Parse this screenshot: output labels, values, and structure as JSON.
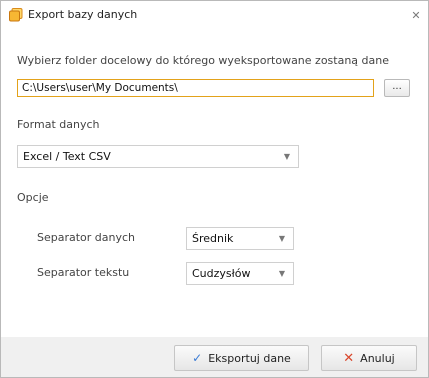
{
  "window": {
    "title": "Export bazy danych",
    "icon": "export-database-icon",
    "close": "✕"
  },
  "folder": {
    "label": "Wybierz folder docelowy do którego wyeksportowane zostaną dane",
    "path": "C:\\Users\\user\\My Documents\\",
    "browse_label": "..."
  },
  "format": {
    "label": "Format danych",
    "selected": "Excel / Text CSV"
  },
  "options": {
    "label": "Opcje",
    "data_separator_label": "Separator danych",
    "data_separator_value": "Średnik",
    "text_separator_label": "Separator tekstu",
    "text_separator_value": "Cudzysłów"
  },
  "buttons": {
    "export_label": "Eksportuj dane",
    "cancel_label": "Anuluj"
  },
  "colors": {
    "accent_border": "#e3a21a",
    "export_icon": "#3a7bd5",
    "cancel_icon": "#d9462b"
  }
}
